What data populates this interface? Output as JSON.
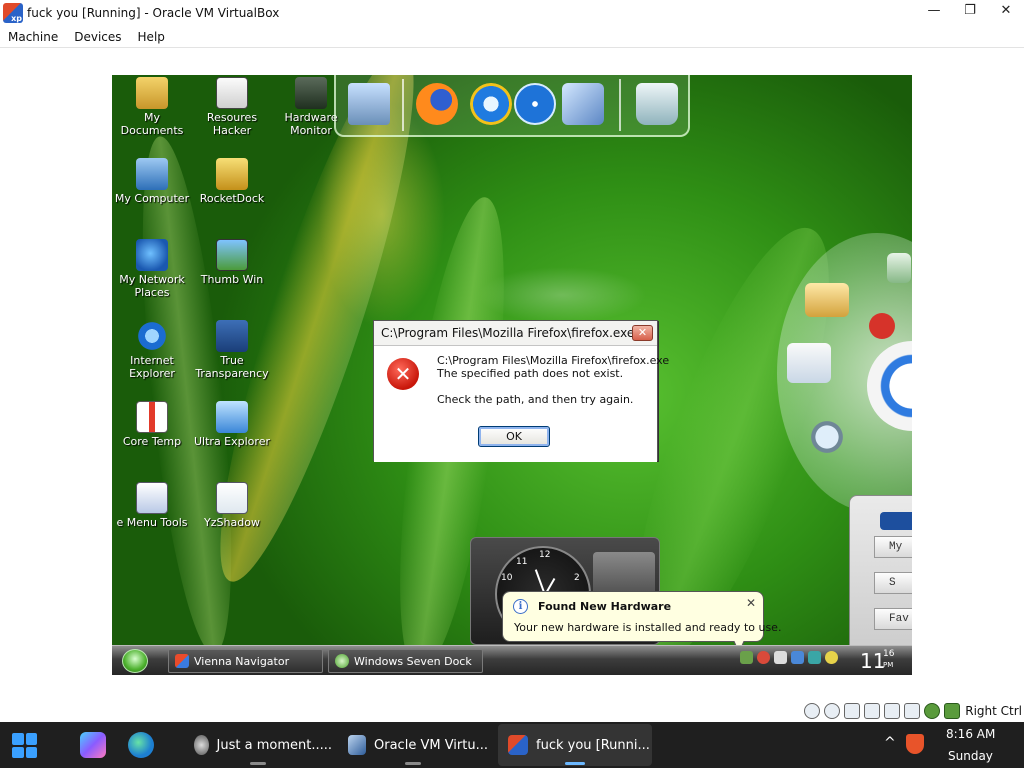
{
  "host_window": {
    "title": "fuck you [Running] - Oracle VM VirtualBox",
    "app_icon_text": "xp",
    "controls": {
      "minimize": "—",
      "maximize": "❐",
      "close": "✕"
    },
    "menu": [
      "Machine",
      "Devices",
      "Help"
    ],
    "host_key_label": "Right Ctrl"
  },
  "guest": {
    "desktop_icons": [
      {
        "label": "My Documents",
        "icon": "folder-documents-icon"
      },
      {
        "label": "Resoures Hacker",
        "icon": "resource-hacker-icon"
      },
      {
        "label": "Hardware Monitor",
        "icon": "hardware-monitor-icon"
      },
      {
        "label": "My Computer",
        "icon": "my-computer-icon"
      },
      {
        "label": "RocketDock",
        "icon": "rocketdock-icon"
      },
      {
        "label": "My Network Places",
        "icon": "network-places-icon"
      },
      {
        "label": "Thumb Win",
        "icon": "thumb-win-icon"
      },
      {
        "label": "Internet Explorer",
        "icon": "internet-explorer-icon"
      },
      {
        "label": "True Transparency",
        "icon": "true-transparency-icon"
      },
      {
        "label": "Core Temp",
        "icon": "core-temp-icon"
      },
      {
        "label": "Ultra Explorer",
        "icon": "ultra-explorer-icon"
      },
      {
        "label": "e Menu Tools",
        "icon": "menu-tools-icon"
      },
      {
        "label": "YzShadow",
        "icon": "yzshadow-icon"
      }
    ],
    "dock_items": [
      "monitor-icon",
      "firefox-icon",
      "internet-explorer-icon",
      "media-player-icon",
      "network-icon",
      "recycle-bin-icon"
    ],
    "error_dialog": {
      "title": "C:\\Program Files\\Mozilla Firefox\\firefox.exe",
      "line1": "C:\\Program Files\\Mozilla Firefox\\firefox.exe",
      "line2": "The specified path does not exist.",
      "line3": "Check the path, and then try again.",
      "ok_label": "OK",
      "close_glyph": "✕",
      "icon_glyph": "✕"
    },
    "balloon": {
      "info_glyph": "i",
      "title": "Found New Hardware",
      "text": "Your new hardware is installed and ready to use.",
      "close_glyph": "✕"
    },
    "clock_gadget": {
      "numbers": [
        "12",
        "11",
        "10",
        "2"
      ]
    },
    "sidebar_buttons": [
      "My",
      "S",
      "Fav"
    ],
    "taskbar": {
      "tasks": [
        "Vienna Navigator",
        "Windows Seven Dock"
      ],
      "clock_hour": "11",
      "clock_minute": "16",
      "clock_ampm": "PM"
    }
  },
  "host_taskbar": {
    "apps": [
      {
        "label": "Just a moment.....",
        "active": false
      },
      {
        "label": "Oracle VM Virtu...",
        "active": false
      },
      {
        "label": "fuck you [Runni...",
        "active": true
      }
    ],
    "tray_chevron": "^",
    "time": "8:16 AM",
    "day": "Sunday"
  },
  "colors": {
    "win11_accent": "#3aa0ff",
    "error_red": "#c8160a",
    "balloon_bg": "#ffffe1",
    "xp_green": "#4db12e"
  }
}
